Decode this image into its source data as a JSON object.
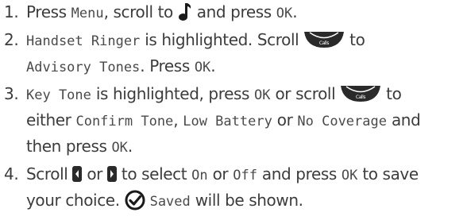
{
  "steps": [
    {
      "num": "1.",
      "t1": "Press ",
      "lcd1": "Menu",
      "t2": ", scroll to ",
      "icon1": "music-note-icon",
      "t3": " and press ",
      "lcd2": "OK",
      "t4": "."
    },
    {
      "num": "2.",
      "lcd1": "Handset Ringer",
      "t1": " is highlighted. Scroll ",
      "icon1": "scroll-down-key-icon",
      "icon1_label": "Calls",
      "t2": " to",
      "lcd2": "Advisory Tones",
      "t3": ". Press ",
      "lcd3": "OK",
      "t4": "."
    },
    {
      "num": "3.",
      "lcd1": "Key Tone",
      "t1": " is highlighted, press ",
      "lcd2": "OK",
      "t2": " or scroll ",
      "icon1": "scroll-down-key-icon",
      "icon1_label": "Calls",
      "t3": " to",
      "t4": "either ",
      "lcd3": "Confirm Tone",
      "t5": ", ",
      "lcd4": "Low Battery",
      "t6": " or ",
      "lcd5": "No Coverage",
      "t7": " and",
      "t8": "then press ",
      "lcd6": "OK",
      "t9": "."
    },
    {
      "num": "4.",
      "t1": "Scroll ",
      "icon1": "left-arrow-key-icon",
      "t2": " or ",
      "icon2": "right-arrow-key-icon",
      "t3": " to select ",
      "lcd1": "On",
      "t4": " or ",
      "lcd2": "Off",
      "t5": " and press ",
      "lcd3": "OK",
      "t6": " to save",
      "t7": "your choice. ",
      "icon3": "check-circle-icon",
      "t8": " ",
      "lcd4": "Saved",
      "t9": " will be shown."
    }
  ],
  "colors": {
    "text": "#3c3c3c",
    "icon": "#1a1a1a"
  }
}
